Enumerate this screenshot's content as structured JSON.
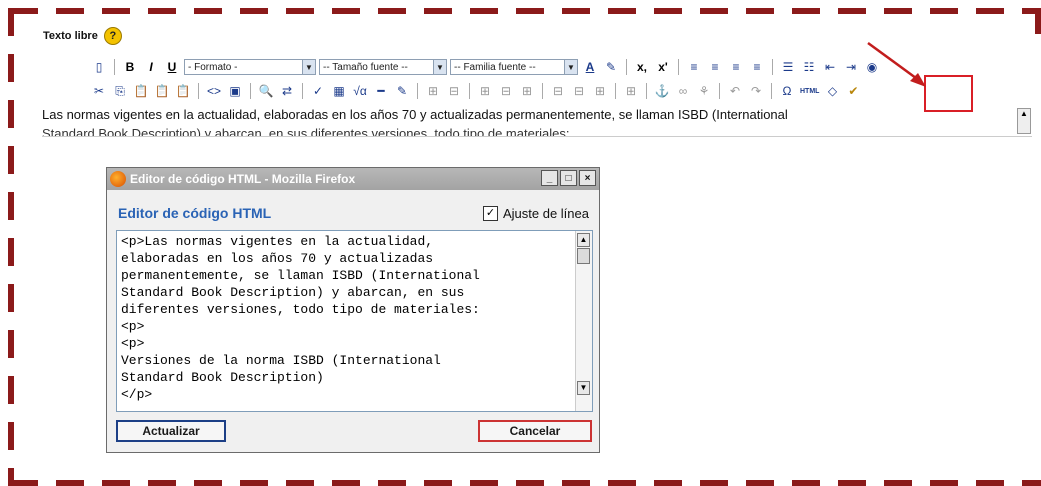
{
  "field": {
    "label": "Texto libre",
    "help_icon": "question-circle-icon"
  },
  "toolbar_row1": {
    "format_label": "- Formato -",
    "size_label": "-- Tamaño fuente --",
    "family_label": "-- Familia fuente --",
    "bold": "B",
    "italic": "I",
    "underline": "U",
    "new_icon": "new-document-icon",
    "text_color": "A",
    "bg_color": "✎",
    "subscript": "x,",
    "superscript": "x'"
  },
  "toolbar_row2": {
    "items": [
      "✂",
      "⎘",
      "📋",
      "📋",
      "📋",
      "<>",
      "▣",
      "🔍",
      "⇄",
      "✓",
      "▦",
      "√α",
      "━",
      "✎",
      "⊞",
      "⊟",
      "⊞",
      "⊟",
      "⊞",
      "⊟",
      "⊟",
      "⊞",
      "⊞",
      "⚓",
      "∞",
      "⚘",
      "↶",
      "↷",
      "Ω",
      "HTML",
      "◇",
      "✔"
    ]
  },
  "editor": {
    "line1": "Las normas vigentes en la actualidad, elaboradas en los años 70 y actualizadas permanentemente, se llaman ISBD (International",
    "line2": "Standard Book Description) y abarcan, en sus diferentes versiones, todo tipo de materiales:"
  },
  "popup": {
    "title": "Editor de código HTML - Mozilla Firefox",
    "minimize": "_",
    "maximize": "□",
    "close": "×",
    "header": "Editor de código HTML",
    "wrap_label": "Ajuste de línea",
    "wrap_checked": "✓",
    "code": "<p>Las normas vigentes en la actualidad,\nelaboradas en los años 70 y actualizadas\npermanentemente, se llaman ISBD (International\nStandard Book Description) y abarcan, en sus\ndiferentes versiones, todo tipo de materiales:\n<p>\n<p>\nVersiones de la norma ISBD (International\nStandard Book Description)\n</p>",
    "update_button": "Actualizar",
    "cancel_button": "Cancelar"
  },
  "colors": {
    "accent_dash": "#8b1a1a",
    "highlight": "#d91f26",
    "link_blue": "#2a63b5"
  }
}
